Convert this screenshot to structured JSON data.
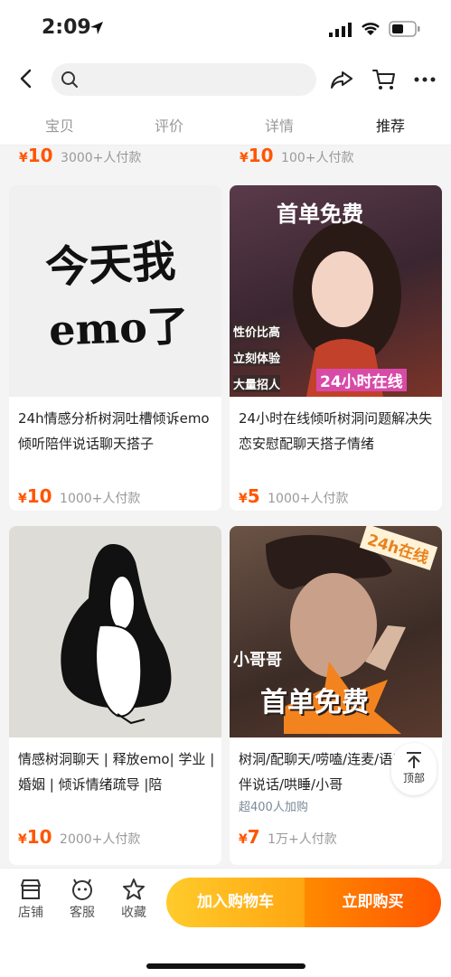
{
  "status_bar": {
    "time": "2:09"
  },
  "tabs": [
    {
      "label": "宝贝",
      "active": false
    },
    {
      "label": "评价",
      "active": false
    },
    {
      "label": "详情",
      "active": false
    },
    {
      "label": "推荐",
      "active": true
    }
  ],
  "partial_row": [
    {
      "currency": "¥",
      "price": "10",
      "sales": "3000+人付款"
    },
    {
      "currency": "¥",
      "price": "10",
      "sales": "100+人付款"
    }
  ],
  "products": [
    {
      "title": "24h情感分析树洞吐槽倾诉emo倾听陪伴说话聊天搭子",
      "currency": "¥",
      "price": "10",
      "sales": "1000+人付款",
      "image_text": [
        "今天我",
        "emo了"
      ]
    },
    {
      "title": "24小时在线倾听树洞问题解决失恋安慰配聊天搭子情绪",
      "currency": "¥",
      "price": "5",
      "sales": "1000+人付款",
      "image_text": [
        "首单免费",
        "性价比高",
        "立刻体验",
        "大量招人",
        "24小时在线"
      ]
    },
    {
      "title": "情感树洞聊天 | 释放emo| 学业 | 婚姻 | 倾诉情绪疏导 |陪",
      "currency": "¥",
      "price": "10",
      "sales": "2000+人付款",
      "image_text": []
    },
    {
      "title": "树洞/配聊天/唠嗑/连麦/语音/陪伴说话/哄睡/小哥",
      "subtitle": "超400人加购",
      "currency": "¥",
      "price": "7",
      "sales": "1万+人付款",
      "image_text": [
        "24h在线",
        "小哥哥",
        "首单免费"
      ]
    }
  ],
  "top_button": {
    "label": "顶部"
  },
  "bottom_bar": {
    "shop": "店铺",
    "service": "客服",
    "favorite": "收藏",
    "add_cart": "加入购物车",
    "buy_now": "立即购买"
  },
  "colors": {
    "accent": "#ff5500",
    "cart_button": "#ffb01a",
    "buy_button": "#ff6a00"
  }
}
